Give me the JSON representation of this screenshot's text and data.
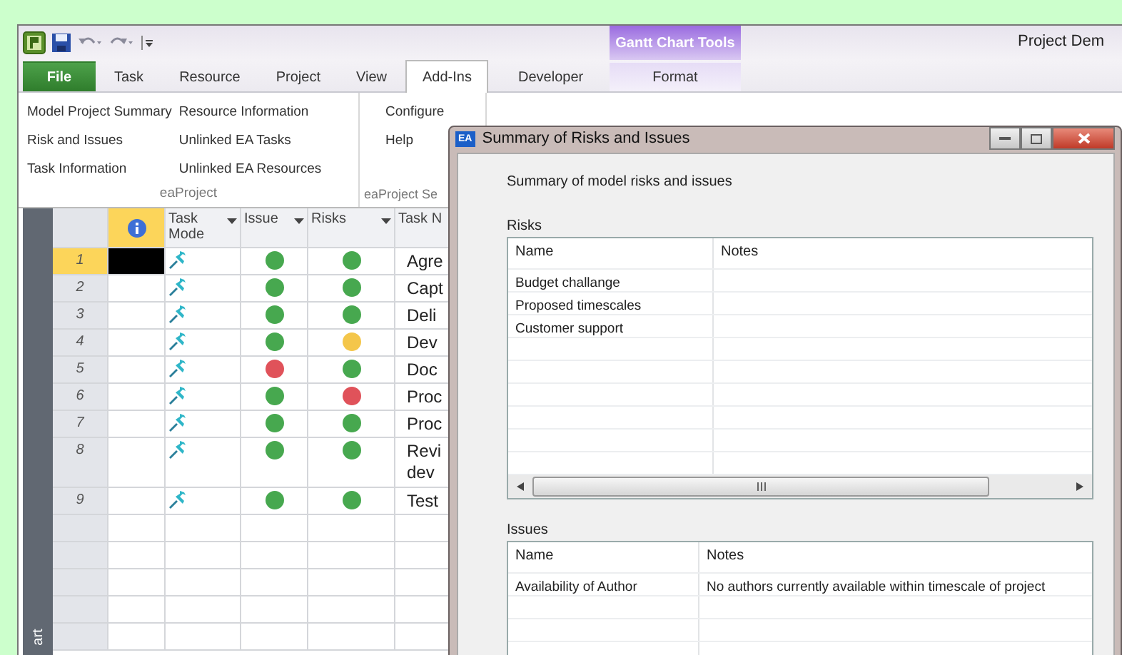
{
  "window": {
    "title": "Project Dem"
  },
  "contextual_header": "Gantt Chart Tools",
  "tabs": [
    {
      "label": "File",
      "kind": "file",
      "selected": false
    },
    {
      "label": "Task",
      "kind": "normal",
      "selected": false
    },
    {
      "label": "Resource",
      "kind": "normal",
      "selected": false
    },
    {
      "label": "Project",
      "kind": "normal",
      "selected": false
    },
    {
      "label": "View",
      "kind": "normal",
      "selected": false
    },
    {
      "label": "Add-Ins",
      "kind": "normal",
      "selected": true
    },
    {
      "label": "Developer",
      "kind": "normal",
      "selected": false
    },
    {
      "label": "Format",
      "kind": "contextual",
      "selected": false
    }
  ],
  "ribbon_groups": [
    {
      "label": "eaProject",
      "columns": [
        [
          "Model Project Summary",
          "Risk and Issues",
          "Task Information"
        ],
        [
          "Resource Information",
          "Unlinked EA Tasks",
          "Unlinked EA Resources"
        ]
      ]
    },
    {
      "label": "eaProject Se",
      "columns": [
        [
          "Configure",
          "Help"
        ]
      ]
    }
  ],
  "grid": {
    "side_label": "art",
    "columns": [
      {
        "label": "Task Mode",
        "filter": true
      },
      {
        "label": "Issue",
        "filter": true
      },
      {
        "label": "Risks",
        "filter": true
      },
      {
        "label": "Task N",
        "filter": false
      }
    ],
    "rows": [
      {
        "number": "1",
        "selected": true,
        "issue": {
          "color": "#47a84f"
        },
        "risks": {
          "color": "#47a84f"
        },
        "name": "Agre"
      },
      {
        "number": "2",
        "selected": false,
        "issue": {
          "color": "#47a84f"
        },
        "risks": {
          "color": "#47a84f"
        },
        "name": "Capt"
      },
      {
        "number": "3",
        "selected": false,
        "issue": {
          "color": "#47a84f"
        },
        "risks": {
          "color": "#47a84f"
        },
        "name": "Deli"
      },
      {
        "number": "4",
        "selected": false,
        "issue": {
          "color": "#47a84f"
        },
        "risks": {
          "color": "#f4c64a"
        },
        "name": "Dev"
      },
      {
        "number": "5",
        "selected": false,
        "issue": {
          "color": "#e0525a"
        },
        "risks": {
          "color": "#47a84f"
        },
        "name": "Doc"
      },
      {
        "number": "6",
        "selected": false,
        "issue": {
          "color": "#47a84f"
        },
        "risks": {
          "color": "#e0525a"
        },
        "name": "Proc"
      },
      {
        "number": "7",
        "selected": false,
        "issue": {
          "color": "#47a84f"
        },
        "risks": {
          "color": "#47a84f"
        },
        "name": "Proc"
      },
      {
        "number": "8",
        "selected": false,
        "issue": {
          "color": "#47a84f"
        },
        "risks": {
          "color": "#47a84f"
        },
        "name": "Revi dev"
      },
      {
        "number": "9",
        "selected": false,
        "issue": {
          "color": "#47a84f"
        },
        "risks": {
          "color": "#47a84f"
        },
        "name": "Test"
      }
    ]
  },
  "dialog": {
    "badge": "EA",
    "title": "Summary of Risks and Issues",
    "intro": "Summary of model risks and issues",
    "risks": {
      "label": "Risks",
      "columns": [
        "Name",
        "Notes"
      ],
      "rows": [
        {
          "name": "Budget challange"
        },
        {
          "name": "Proposed timescales"
        },
        {
          "name": "Customer support"
        }
      ]
    },
    "issues": {
      "label": "Issues",
      "columns": [
        "Name",
        "Notes"
      ],
      "rows": [
        {
          "name": "Availability of Author",
          "notes": "No authors currently available within timescale of project"
        }
      ]
    }
  }
}
